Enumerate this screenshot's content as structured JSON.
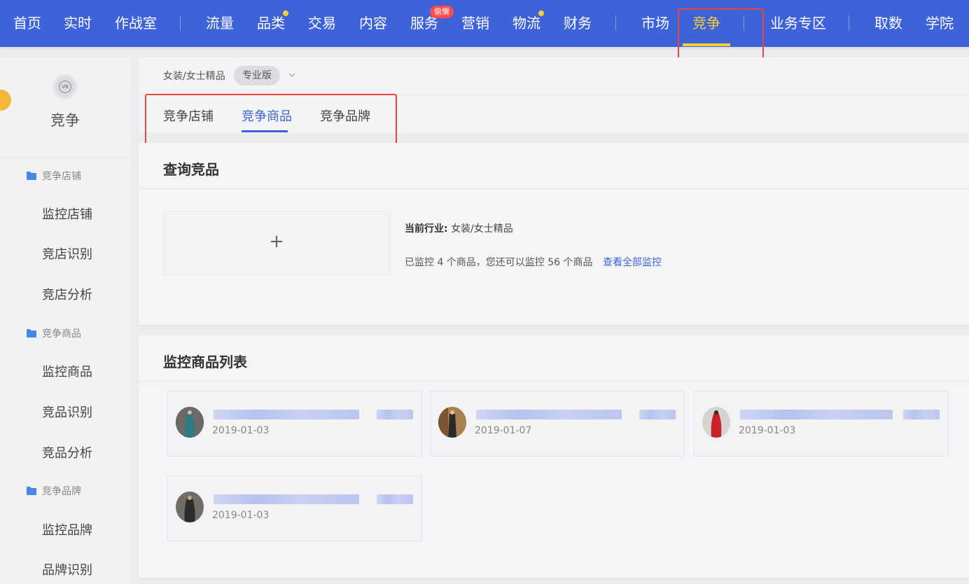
{
  "topnav": {
    "items": [
      "首页",
      "实时",
      "作战室",
      "流量",
      "品类",
      "交易",
      "内容",
      "服务",
      "营销",
      "物流",
      "财务",
      "市场",
      "竞争",
      "业务专区",
      "取数",
      "学院"
    ],
    "service_badge": "偷懒",
    "active": "竞争",
    "bg_color": "#3e63d8",
    "accent_color": "#f5d033"
  },
  "sidebar": {
    "title": "竞争",
    "logo_text": "VB",
    "groups": [
      {
        "label": "竞争店铺",
        "items": [
          "监控店铺",
          "竞店识别",
          "竞店分析"
        ]
      },
      {
        "label": "竞争商品",
        "items": [
          "监控商品",
          "竞品识别",
          "竞品分析"
        ]
      },
      {
        "label": "竞争品牌",
        "items": [
          "监控品牌",
          "品牌识别"
        ]
      }
    ]
  },
  "crumb": {
    "industry": "女装/女士精品",
    "edition": "专业版"
  },
  "subtabs": [
    "竞争店铺",
    "竞争商品",
    "竞争品牌"
  ],
  "active_subtab": "竞争商品",
  "query_panel": {
    "title": "查询竞品",
    "upload_symbol": "+",
    "industry_label": "当前行业:",
    "industry_value": "女装/女士精品",
    "monitor_text": "已监控 4 个商品，您还可以监控 56 个商品",
    "view_all_link": "查看全部监控"
  },
  "list_panel": {
    "title": "监控商品列表",
    "cards": [
      {
        "date": "2019-01-03"
      },
      {
        "date": "2019-01-07"
      },
      {
        "date": "2019-01-03"
      },
      {
        "date": "2019-01-03"
      }
    ]
  }
}
